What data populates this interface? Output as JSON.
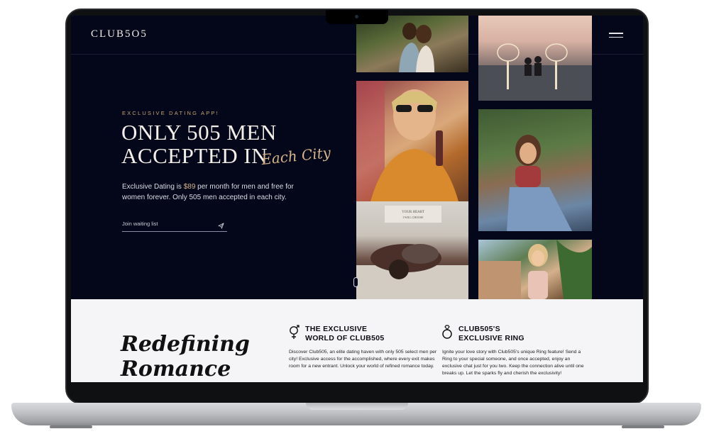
{
  "site": {
    "logo": "CLUB5O5"
  },
  "hero": {
    "eyebrow": "EXCLUSIVE DATING APP!",
    "headline_line1": "ONLY 505 MEN",
    "headline_line2": "ACCEPTED IN",
    "headline_script": "Each City",
    "description_before": "Exclusive Dating is ",
    "description_price": "$89",
    "description_after": " per month for men and free for women forever. Only 505 men accepted in each city.",
    "waitlist_placeholder": "Join waiting list"
  },
  "gallery": {
    "photo_count": 6
  },
  "section": {
    "title_line1": "Redefining",
    "title_line2": "Romance",
    "features": [
      {
        "icon": "gender-icon",
        "title_line1": "THE EXCLUSIVE",
        "title_line2": "WORLD OF CLUB505",
        "text": "Discover Club505, an elite dating haven with only 505 select men per city! Exclusive access for the accomplished, where every exit makes room for a new entrant. Unlock your world of refined romance today."
      },
      {
        "icon": "ring-icon",
        "title_line1": "CLUB505'S",
        "title_line2": "EXCLUSIVE RING",
        "text": "Ignite your love story with Club505's unique Ring feature! Send a Ring to your special someone, and once accepted, enjoy an exclusive chat just for you two. Keep the connection alive until one breaks up. Let the sparks fly and cherish the exclusivity!"
      }
    ]
  },
  "colors": {
    "background_dark": "#04071a",
    "accent_gold": "#d6b48a",
    "light_section": "#f5f5f7"
  }
}
